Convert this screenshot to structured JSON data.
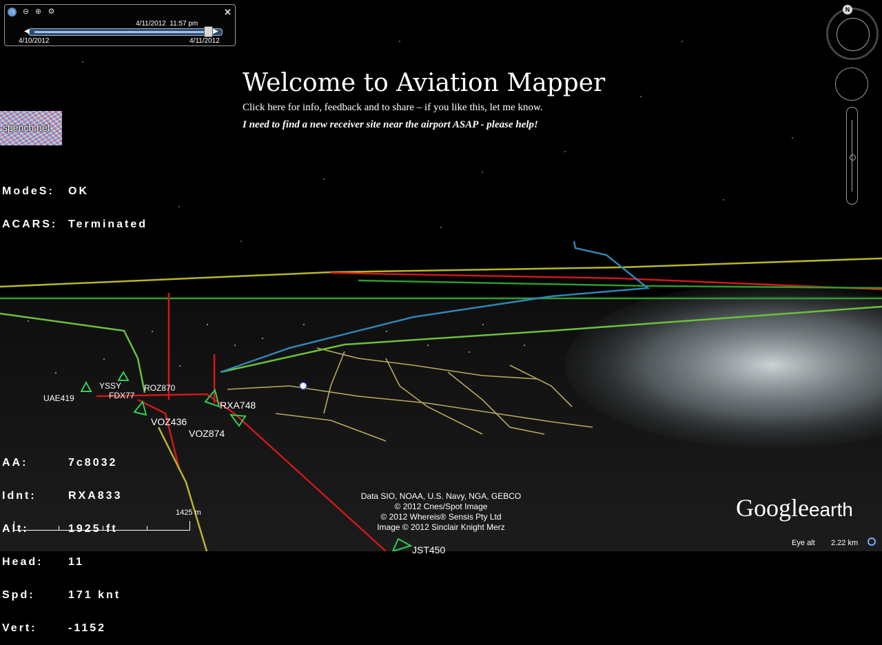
{
  "window": {
    "title": "Aviation Mapper"
  },
  "time_slider": {
    "current": "4/11/2012  11:57 pm",
    "start": "4/10/2012",
    "end": "4/11/2012",
    "position_fraction": 0.93
  },
  "banner": {
    "title": "Welcome to Aviation Mapper",
    "subtitle": "Click here for info, feedback and to share – if you like this, let me know.",
    "help": "I need to find a new receiver site near the airport ASAP - please help!"
  },
  "logo": {
    "text": "spench.net"
  },
  "status": [
    {
      "key": "ModeS:",
      "value": "OK"
    },
    {
      "key": "ACARS:",
      "value": "Terminated"
    }
  ],
  "selected_aircraft": [
    {
      "key": "AA:",
      "value": "7c8032"
    },
    {
      "key": "Idnt:",
      "value": "RXA833"
    },
    {
      "key": "Alt:",
      "value": "1925 ft"
    },
    {
      "key": "Head:",
      "value": "11"
    },
    {
      "key": "Spd:",
      "value": "171 knt"
    },
    {
      "key": "Vert:",
      "value": "-1152"
    }
  ],
  "aircraft_labels": {
    "uae419": "UAE419",
    "yssy": "YSSY",
    "fdx77": "FDX77",
    "roz870": "ROZ870",
    "rxa748": "RXA748",
    "voz436": "VOZ436",
    "voz874": "VOZ874",
    "jst450": "JST450"
  },
  "navigation": {
    "north": "N"
  },
  "scale": {
    "label": "1425 m"
  },
  "credits": [
    "Data SIO, NOAA, U.S. Navy, NGA, GEBCO",
    "© 2012 Cnes/Spot Image",
    "© 2012 Whereis® Sensis Pty Ltd",
    "Image © 2012 Sinclair Knight Merz"
  ],
  "google_earth": {
    "google": "Google",
    "earth": "earth"
  },
  "eye_alt": {
    "label": "Eye alt",
    "value": "2.22 km"
  },
  "colors": {
    "track_red": "#d01818",
    "track_green": "#2e9a2e",
    "track_yellow": "#b9b62a",
    "track_blue": "#2f86b8",
    "track_lightgreen": "#6cc13a",
    "city_lights": "#d8c46a"
  }
}
